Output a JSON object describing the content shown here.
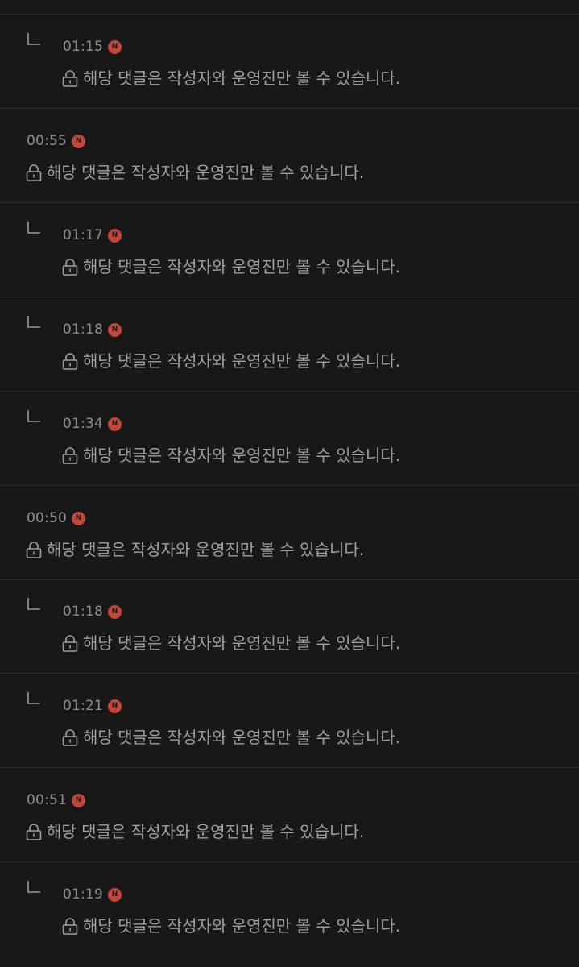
{
  "comments": [
    {
      "type": "reply",
      "time": "01:15",
      "badge": "N",
      "text": "해당 댓글은 작성자와 운영진만 볼 수 있습니다."
    },
    {
      "type": "top",
      "time": "00:55",
      "badge": "N",
      "text": "해당 댓글은 작성자와 운영진만 볼 수 있습니다."
    },
    {
      "type": "reply",
      "time": "01:17",
      "badge": "N",
      "text": "해당 댓글은 작성자와 운영진만 볼 수 있습니다."
    },
    {
      "type": "reply",
      "time": "01:18",
      "badge": "N",
      "text": "해당 댓글은 작성자와 운영진만 볼 수 있습니다."
    },
    {
      "type": "reply",
      "time": "01:34",
      "badge": "N",
      "text": "해당 댓글은 작성자와 운영진만 볼 수 있습니다."
    },
    {
      "type": "top",
      "time": "00:50",
      "badge": "N",
      "text": "해당 댓글은 작성자와 운영진만 볼 수 있습니다."
    },
    {
      "type": "reply",
      "time": "01:18",
      "badge": "N",
      "text": "해당 댓글은 작성자와 운영진만 볼 수 있습니다."
    },
    {
      "type": "reply",
      "time": "01:21",
      "badge": "N",
      "text": "해당 댓글은 작성자와 운영진만 볼 수 있습니다."
    },
    {
      "type": "top",
      "time": "00:51",
      "badge": "N",
      "text": "해당 댓글은 작성자와 운영진만 볼 수 있습니다."
    },
    {
      "type": "reply",
      "time": "01:19",
      "badge": "N",
      "text": "해당 댓글은 작성자와 운영진만 볼 수 있습니다."
    }
  ],
  "icons": {
    "lock": "lock-icon",
    "reply": "reply-arrow-icon",
    "new_badge": "new-badge-icon"
  },
  "colors": {
    "background": "#181818",
    "divider": "#2c2c2c",
    "badge": "#c4453a",
    "text": "#a0a0a0"
  }
}
